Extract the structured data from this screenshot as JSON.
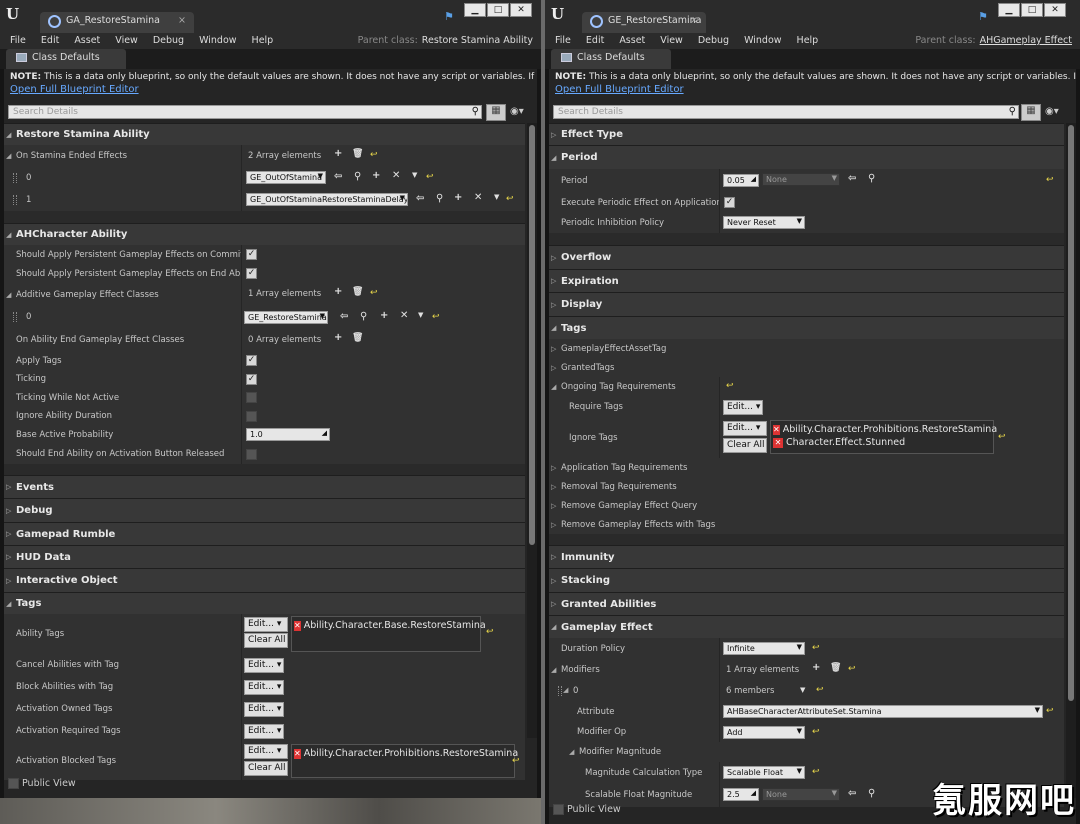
{
  "left": {
    "tab_title": "GA_RestoreStamina",
    "menu": [
      "File",
      "Edit",
      "Asset",
      "View",
      "Debug",
      "Window",
      "Help"
    ],
    "parent_class_label": "Parent class:",
    "parent_class": "Restore Stamina Ability",
    "panel_tab": "Class Defaults",
    "note_bold": "NOTE:",
    "note_text": " This is a data only blueprint, so only the default values are shown.  It does not have any script or variables.  If you",
    "open_editor": "Open Full Blueprint Editor",
    "search_placeholder": "Search Details",
    "cat_restore": "Restore Stamina Ability",
    "on_stamina_ended": "On Stamina Ended Effects",
    "on_stamina_ended_value": "2 Array elements",
    "elem0_index": "0",
    "elem0_value": "GE_OutOfStamina",
    "elem1_index": "1",
    "elem1_value": "GE_OutOfStaminaRestoreStaminaDelay",
    "cat_ahcharacter": "AHCharacter Ability",
    "apply_commit": "Should Apply Persistent Gameplay Effects on Commit",
    "apply_end": "Should Apply Persistent Gameplay Effects on End Ability",
    "additive": "Additive Gameplay Effect Classes",
    "additive_value": "1 Array elements",
    "add_elem0_index": "0",
    "add_elem0_value": "GE_RestoreStamina",
    "on_end": "On Ability End Gameplay Effect Classes",
    "on_end_value": "0 Array elements",
    "apply_tags": "Apply Tags",
    "ticking": "Ticking",
    "ticking_inactive": "Ticking While Not Active",
    "ignore_duration": "Ignore Ability Duration",
    "base_prob": "Base Active Probability",
    "base_prob_value": "1.0",
    "should_end": "Should End Ability on Activation Button Released",
    "cat_events": "Events",
    "cat_debug": "Debug",
    "cat_gamepad": "Gamepad Rumble",
    "cat_hud": "HUD Data",
    "cat_interactive": "Interactive Object",
    "cat_tags": "Tags",
    "ability_tags": "Ability Tags",
    "ability_tag_value": "Ability.Character.Base.RestoreStamina",
    "cancel_tags": "Cancel Abilities with Tag",
    "block_tags": "Block Abilities with Tag",
    "owned_tags": "Activation Owned Tags",
    "required_tags": "Activation Required Tags",
    "blocked_tags": "Activation Blocked Tags",
    "blocked_tag_value": "Ability.Character.Prohibitions.RestoreStamina",
    "edit": "Edit...",
    "clear_all": "Clear All",
    "public_view": "Public View"
  },
  "right": {
    "tab_title": "GE_RestoreStamina",
    "menu": [
      "File",
      "Edit",
      "Asset",
      "View",
      "Debug",
      "Window",
      "Help"
    ],
    "parent_class_label": "Parent class:",
    "parent_class": "AHGameplay Effect",
    "panel_tab": "Class Defaults",
    "note_bold": "NOTE:",
    "note_text": " This is a data only blueprint, so only the default values are shown.  It does not have any script or variables.  If yo",
    "open_editor": "Open Full Blueprint Editor",
    "search_placeholder": "Search Details",
    "cat_effect_type": "Effect Type",
    "cat_period": "Period",
    "period": "Period",
    "period_value": "0.05",
    "none": "None",
    "exec_periodic": "Execute Periodic Effect on Application",
    "inhibition": "Periodic Inhibition Policy",
    "inhibition_value": "Never Reset",
    "cat_overflow": "Overflow",
    "cat_expiration": "Expiration",
    "cat_display": "Display",
    "cat_tags": "Tags",
    "asset_tag": "GameplayEffectAssetTag",
    "granted_tags": "GrantedTags",
    "ongoing": "Ongoing Tag Requirements",
    "require_tags": "Require Tags",
    "ignore_tags": "Ignore Tags",
    "ignore_tag1": "Ability.Character.Prohibitions.RestoreStamina",
    "ignore_tag2": "Character.Effect.Stunned",
    "app_tag_req": "Application Tag Requirements",
    "removal_req": "Removal Tag Requirements",
    "remove_query": "Remove Gameplay Effect Query",
    "remove_with_tags": "Remove Gameplay Effects with Tags",
    "cat_immunity": "Immunity",
    "cat_stacking": "Stacking",
    "cat_granted": "Granted Abilities",
    "cat_gameplay_effect": "Gameplay Effect",
    "duration": "Duration Policy",
    "duration_value": "Infinite",
    "modifiers": "Modifiers",
    "modifiers_value": "1 Array elements",
    "mod0": "0",
    "mod0_value": "6 members",
    "attribute": "Attribute",
    "attribute_value": "AHBaseCharacterAttributeSet.Stamina",
    "modifier_op": "Modifier Op",
    "modifier_op_value": "Add",
    "magnitude": "Modifier Magnitude",
    "calc_type": "Magnitude Calculation Type",
    "calc_type_value": "Scalable Float",
    "scalable": "Scalable Float Magnitude",
    "scalable_value": "2.5",
    "edit": "Edit...",
    "clear_all": "Clear All",
    "public_view": "Public View"
  },
  "watermark": "氪服网吧"
}
